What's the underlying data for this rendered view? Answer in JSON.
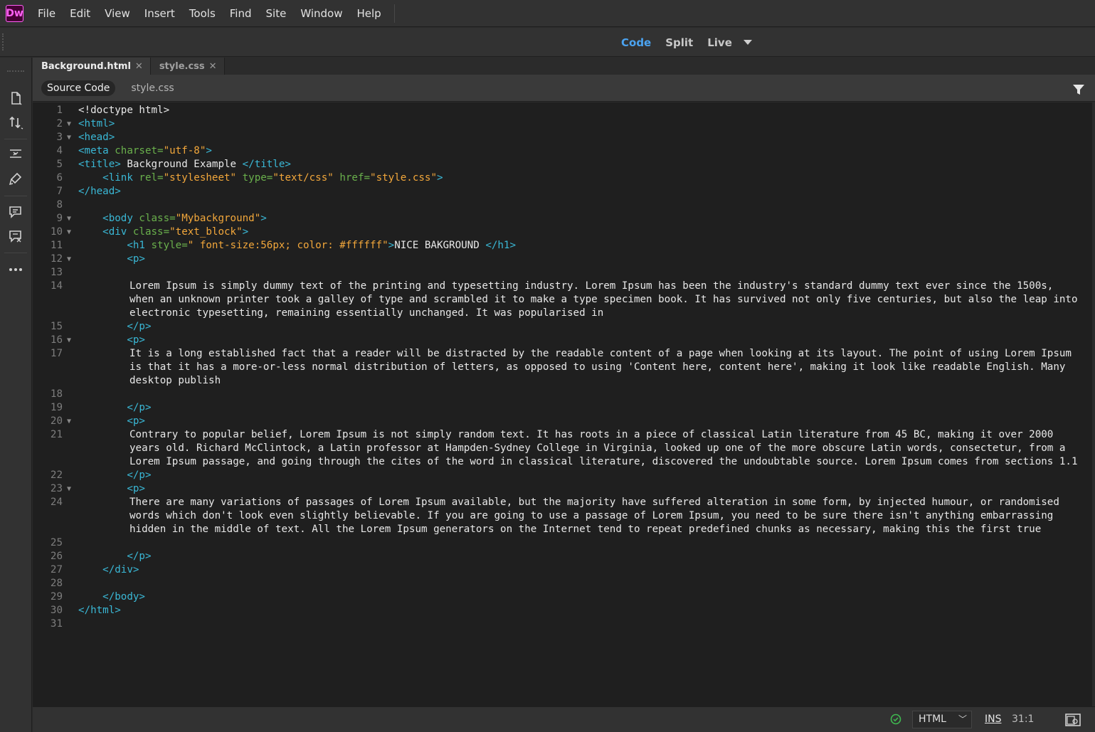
{
  "app": {
    "logo_text": "Dw"
  },
  "menu": [
    "File",
    "Edit",
    "View",
    "Insert",
    "Tools",
    "Find",
    "Site",
    "Window",
    "Help"
  ],
  "view_switcher": {
    "code": "Code",
    "split": "Split",
    "live": "Live",
    "active": "Code"
  },
  "tabs": [
    {
      "label": "Background.html",
      "active": true
    },
    {
      "label": "style.css",
      "active": false
    }
  ],
  "related_files": {
    "source_code": "Source Code",
    "css": "style.css"
  },
  "status": {
    "language": "HTML",
    "insert_mode": "INS",
    "cursor": "31:1"
  },
  "colors": {
    "tag": "#3ab8d6",
    "attr": "#6ab04c",
    "value": "#f2a73b",
    "active_view": "#4ba3f0",
    "logo": "#ff61f6"
  },
  "code_lines": [
    {
      "n": "1",
      "fold": false,
      "tokens": [
        [
          "tx",
          "<!doctype html>"
        ]
      ]
    },
    {
      "n": "2",
      "fold": true,
      "tokens": [
        [
          "tg",
          "<html>"
        ]
      ]
    },
    {
      "n": "3",
      "fold": true,
      "tokens": [
        [
          "tg",
          "<head>"
        ]
      ]
    },
    {
      "n": "4",
      "fold": false,
      "tokens": [
        [
          "tg",
          "<meta "
        ],
        [
          "at",
          "charset="
        ],
        [
          "vl",
          "\"utf-8\""
        ],
        [
          "tg",
          ">"
        ]
      ]
    },
    {
      "n": "5",
      "fold": false,
      "tokens": [
        [
          "tg",
          "<title>"
        ],
        [
          "tx",
          " Background Example "
        ],
        [
          "tg",
          "</title>"
        ]
      ]
    },
    {
      "n": "6",
      "fold": false,
      "tokens": [
        [
          "tx",
          "    "
        ],
        [
          "tg",
          "<link "
        ],
        [
          "at",
          "rel="
        ],
        [
          "vl",
          "\"stylesheet\""
        ],
        [
          "tx",
          " "
        ],
        [
          "at",
          "type="
        ],
        [
          "vl",
          "\"text/css\""
        ],
        [
          "tx",
          " "
        ],
        [
          "at",
          "href="
        ],
        [
          "vl",
          "\"style.css\""
        ],
        [
          "tg",
          ">"
        ]
      ]
    },
    {
      "n": "7",
      "fold": false,
      "tokens": [
        [
          "tg",
          "</head>"
        ]
      ]
    },
    {
      "n": "8",
      "fold": false,
      "tokens": []
    },
    {
      "n": "9",
      "fold": true,
      "tokens": [
        [
          "tx",
          "    "
        ],
        [
          "tg",
          "<body "
        ],
        [
          "at",
          "class="
        ],
        [
          "vl",
          "\"Mybackground\""
        ],
        [
          "tg",
          ">"
        ]
      ]
    },
    {
      "n": "10",
      "fold": true,
      "tokens": [
        [
          "tx",
          "    "
        ],
        [
          "tg",
          "<div "
        ],
        [
          "at",
          "class="
        ],
        [
          "vl",
          "\"text_block\""
        ],
        [
          "tg",
          ">"
        ]
      ]
    },
    {
      "n": "11",
      "fold": false,
      "tokens": [
        [
          "tx",
          "        "
        ],
        [
          "tg",
          "<h1 "
        ],
        [
          "at",
          "style="
        ],
        [
          "vl",
          "\" font-size:56px; color: #ffffff\""
        ],
        [
          "tg",
          ">"
        ],
        [
          "tx",
          "NICE BAKGROUND "
        ],
        [
          "tg",
          "</h1>"
        ]
      ]
    },
    {
      "n": "12",
      "fold": true,
      "tokens": [
        [
          "tx",
          "        "
        ],
        [
          "tg",
          "<p>"
        ]
      ]
    },
    {
      "n": "13",
      "fold": false,
      "tokens": []
    },
    {
      "n": "14",
      "fold": false,
      "indent": true,
      "tokens": [
        [
          "tx",
          "Lorem Ipsum is simply dummy text of the printing and typesetting industry. Lorem Ipsum has been the industry's standard dummy text ever since the 1500s, when an unknown printer took a galley of type and scrambled it to make a type specimen book. It has survived not only five centuries, but also the leap into electronic typesetting, remaining essentially unchanged. It was popularised in"
        ]
      ]
    },
    {
      "n": "15",
      "fold": false,
      "tokens": [
        [
          "tx",
          "        "
        ],
        [
          "tg",
          "</p>"
        ]
      ]
    },
    {
      "n": "16",
      "fold": true,
      "tokens": [
        [
          "tx",
          "        "
        ],
        [
          "tg",
          "<p>"
        ]
      ]
    },
    {
      "n": "17",
      "fold": false,
      "indent": true,
      "tokens": [
        [
          "tx",
          "It is a long established fact that a reader will be distracted by the readable content of a page when looking at its layout. The point of using Lorem Ipsum is that it has a more-or-less normal distribution of letters, as opposed to using 'Content here, content here', making it look like readable English. Many desktop publish"
        ]
      ]
    },
    {
      "n": "18",
      "fold": false,
      "tokens": []
    },
    {
      "n": "19",
      "fold": false,
      "tokens": [
        [
          "tx",
          "        "
        ],
        [
          "tg",
          "</p>"
        ]
      ]
    },
    {
      "n": "20",
      "fold": true,
      "tokens": [
        [
          "tx",
          "        "
        ],
        [
          "tg",
          "<p>"
        ]
      ]
    },
    {
      "n": "21",
      "fold": false,
      "indent": true,
      "tokens": [
        [
          "tx",
          "Contrary to popular belief, Lorem Ipsum is not simply random text. It has roots in a piece of classical Latin literature from 45 BC, making it over 2000 years old. Richard McClintock, a Latin professor at Hampden-Sydney College in Virginia, looked up one of the more obscure Latin words, consectetur, from a Lorem Ipsum passage, and going through the cites of the word in classical literature, discovered the undoubtable source. Lorem Ipsum comes from sections 1.1"
        ]
      ]
    },
    {
      "n": "22",
      "fold": false,
      "tokens": [
        [
          "tx",
          "        "
        ],
        [
          "tg",
          "</p>"
        ]
      ]
    },
    {
      "n": "23",
      "fold": true,
      "tokens": [
        [
          "tx",
          "        "
        ],
        [
          "tg",
          "<p>"
        ]
      ]
    },
    {
      "n": "24",
      "fold": false,
      "indent": true,
      "tokens": [
        [
          "tx",
          "There are many variations of passages of Lorem Ipsum available, but the majority have suffered alteration in some form, by injected humour, or randomised words which don't look even slightly believable. If you are going to use a passage of Lorem Ipsum, you need to be sure there isn't anything embarrassing hidden in the middle of text. All the Lorem Ipsum generators on the Internet tend to repeat predefined chunks as necessary, making this the first true"
        ]
      ]
    },
    {
      "n": "25",
      "fold": false,
      "tokens": []
    },
    {
      "n": "26",
      "fold": false,
      "tokens": [
        [
          "tx",
          "        "
        ],
        [
          "tg",
          "</p>"
        ]
      ]
    },
    {
      "n": "27",
      "fold": false,
      "tokens": [
        [
          "tx",
          "    "
        ],
        [
          "tg",
          "</div>"
        ]
      ]
    },
    {
      "n": "28",
      "fold": false,
      "tokens": []
    },
    {
      "n": "29",
      "fold": false,
      "tokens": [
        [
          "tx",
          "    "
        ],
        [
          "tg",
          "</body>"
        ]
      ]
    },
    {
      "n": "30",
      "fold": false,
      "tokens": [
        [
          "tg",
          "</html>"
        ]
      ]
    },
    {
      "n": "31",
      "fold": false,
      "tokens": []
    }
  ]
}
